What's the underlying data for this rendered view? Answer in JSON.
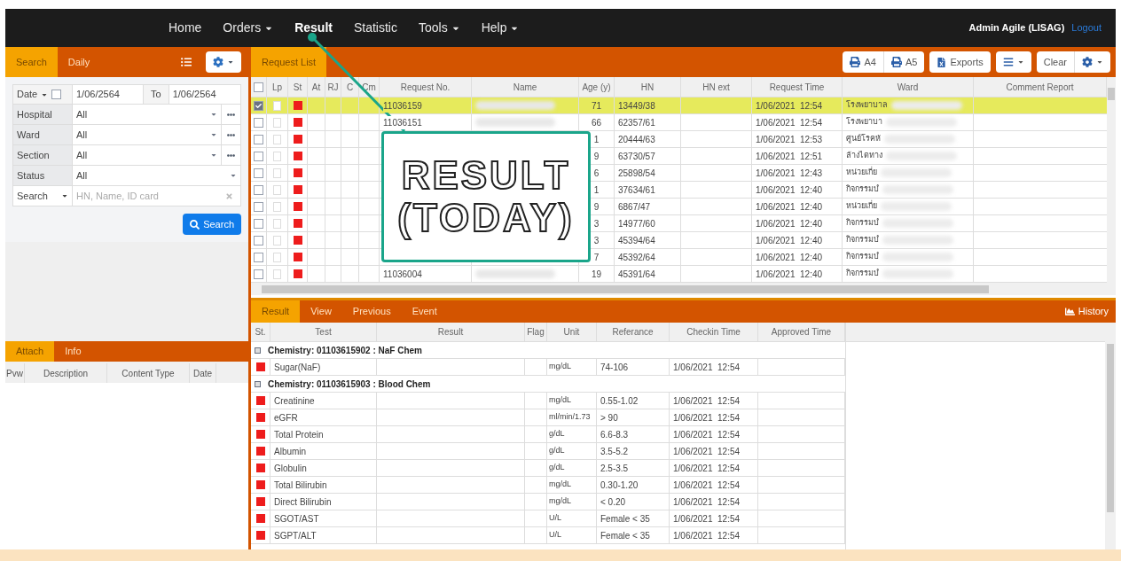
{
  "nav": {
    "items": [
      {
        "label": "Home",
        "dropdown": false,
        "selected": false
      },
      {
        "label": "Orders",
        "dropdown": true,
        "selected": false
      },
      {
        "label": "Result",
        "dropdown": false,
        "selected": true
      },
      {
        "label": "Statistic",
        "dropdown": false,
        "selected": false
      },
      {
        "label": "Tools",
        "dropdown": true,
        "selected": false
      },
      {
        "label": "Help",
        "dropdown": true,
        "selected": false
      }
    ],
    "user": "Admin Agile (LISAG)",
    "logout": "Logout"
  },
  "search_panel": {
    "tabs": [
      {
        "label": "Search",
        "selected": true
      },
      {
        "label": "Daily",
        "selected": false
      }
    ],
    "date": {
      "label": "Date",
      "checked": false,
      "from": "1/06/2564",
      "to_label": "To",
      "to": "1/06/2564"
    },
    "fields": [
      {
        "kind": "select_more",
        "label": "Hospital",
        "value": "All"
      },
      {
        "kind": "select_more",
        "label": "Ward",
        "value": "All"
      },
      {
        "kind": "select_more",
        "label": "Section",
        "value": "All"
      },
      {
        "kind": "select",
        "label": "Status",
        "value": "All"
      },
      {
        "kind": "search",
        "label": "Search",
        "placeholder": "HN, Name, ID card"
      }
    ],
    "button": "Search"
  },
  "attach_panel": {
    "tabs": [
      {
        "label": "Attach",
        "selected": true
      },
      {
        "label": "Info",
        "selected": false
      }
    ],
    "columns": [
      "Pvw",
      "Description",
      "Content Type",
      "Date"
    ]
  },
  "request_list": {
    "tab": "Request List",
    "all_checked": false,
    "buttons": [
      "A4",
      "A5",
      "Exports",
      "Clear"
    ],
    "columns": [
      "Lp",
      "St",
      "At",
      "RJ",
      "C",
      "Cm",
      "Request No.",
      "Name",
      "Age (y)",
      "HN",
      "HN ext",
      "Request Time",
      "Ward",
      "Comment Report"
    ],
    "rows": [
      {
        "selected": true,
        "color": "#ee1c1c",
        "request_no": "11036159",
        "age": "71",
        "hn": "13449/38",
        "time": "1/06/2021  12:54",
        "ward": "โรงพยาบาล"
      },
      {
        "selected": false,
        "color": "#ee1c1c",
        "request_no": "11036151",
        "age": "66",
        "hn": "62357/61",
        "time": "1/06/2021  12:54",
        "ward": "โรงพยาบา"
      },
      {
        "selected": false,
        "color": "#ee1c1c",
        "age": "1",
        "hn": "20444/63",
        "time": "1/06/2021  12:53",
        "ward": "ศูนย์โรคหั"
      },
      {
        "selected": false,
        "color": "#ee1c1c",
        "age": "9",
        "hn": "63730/57",
        "time": "1/06/2021  12:51",
        "ward": "ล้างไตทาง"
      },
      {
        "selected": false,
        "color": "#ee1c1c",
        "age": "6",
        "hn": "25898/54",
        "time": "1/06/2021  12:43",
        "ward": "หน่วยเกี่ย"
      },
      {
        "selected": false,
        "color": "#ee1c1c",
        "age": "1",
        "hn": "37634/61",
        "time": "1/06/2021  12:40",
        "ward": "กิจกรรมบํ"
      },
      {
        "selected": false,
        "color": "#ee1c1c",
        "age": "9",
        "hn": "6867/47",
        "time": "1/06/2021  12:40",
        "ward": "หน่วยเกี่ย"
      },
      {
        "selected": false,
        "color": "#ee1c1c",
        "age": "3",
        "hn": "14977/60",
        "time": "1/06/2021  12:40",
        "ward": "กิจกรรมบํ"
      },
      {
        "selected": false,
        "color": "#ee1c1c",
        "age": "3",
        "hn": "45394/64",
        "time": "1/06/2021  12:40",
        "ward": "กิจกรรมบํ"
      },
      {
        "selected": false,
        "color": "#ee1c1c",
        "age": "7",
        "hn": "45392/64",
        "time": "1/06/2021  12:40",
        "ward": "กิจกรรมบํ"
      },
      {
        "selected": false,
        "color": "#ee1c1c",
        "request_no": "11036004",
        "age": "19",
        "hn": "45391/64",
        "time": "1/06/2021  12:40",
        "ward": "กิจกรรมบํ"
      }
    ]
  },
  "result_panel": {
    "tabs": [
      {
        "label": "Result",
        "selected": true
      },
      {
        "label": "View",
        "selected": false
      },
      {
        "label": "Previous",
        "selected": false
      },
      {
        "label": "Event",
        "selected": false
      }
    ],
    "history": "History",
    "columns": [
      "St.",
      "Test",
      "Result",
      "Flag",
      "Unit",
      "Referance",
      "Checkin Time",
      "Approved Time"
    ],
    "rows": [
      {
        "kind": "group",
        "title": "Chemistry: 01103615902 : NaF Chem"
      },
      {
        "kind": "test",
        "color": "#ee1c1c",
        "test": "Sugar(NaF)",
        "unit": "mg/dL",
        "reference": "74-106",
        "checkin": "1/06/2021  12:54"
      },
      {
        "kind": "group",
        "title": "Chemistry: 01103615903 : Blood Chem"
      },
      {
        "kind": "test",
        "color": "#ee1c1c",
        "test": "Creatinine",
        "unit": "mg/dL",
        "reference": "0.55-1.02",
        "checkin": "1/06/2021  12:54"
      },
      {
        "kind": "test",
        "color": "#ee1c1c",
        "test": "eGFR",
        "unit": "ml/min/1.73",
        "reference": "> 90",
        "checkin": "1/06/2021  12:54"
      },
      {
        "kind": "test",
        "color": "#ee1c1c",
        "test": "Total Protein",
        "unit": "g/dL",
        "reference": "6.6-8.3",
        "checkin": "1/06/2021  12:54"
      },
      {
        "kind": "test",
        "color": "#ee1c1c",
        "test": "Albumin",
        "unit": "g/dL",
        "reference": "3.5-5.2",
        "checkin": "1/06/2021  12:54"
      },
      {
        "kind": "test",
        "color": "#ee1c1c",
        "test": "Globulin",
        "unit": "g/dL",
        "reference": "2.5-3.5",
        "checkin": "1/06/2021  12:54"
      },
      {
        "kind": "test",
        "color": "#ee1c1c",
        "test": "Total Bilirubin",
        "unit": "mg/dL",
        "reference": "0.30-1.20",
        "checkin": "1/06/2021  12:54"
      },
      {
        "kind": "test",
        "color": "#ee1c1c",
        "test": "Direct Bilirubin",
        "unit": "mg/dL",
        "reference": "< 0.20",
        "checkin": "1/06/2021  12:54"
      },
      {
        "kind": "test",
        "color": "#ee1c1c",
        "test": "SGOT/AST",
        "unit": "U/L",
        "reference": "Female < 35",
        "checkin": "1/06/2021  12:54"
      },
      {
        "kind": "test",
        "color": "#ee1c1c",
        "test": "SGPT/ALT",
        "unit": "U/L",
        "reference": "Female < 35",
        "checkin": "1/06/2021  12:54"
      }
    ]
  },
  "callout": {
    "lines": [
      "RESULT",
      "(TODAY)"
    ]
  }
}
